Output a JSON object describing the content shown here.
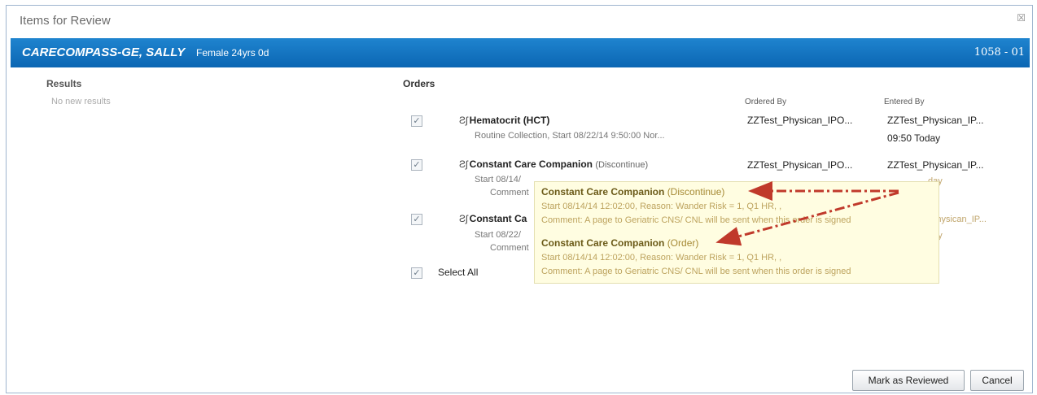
{
  "window": {
    "title": "Items for Review",
    "close_glyph": "☒"
  },
  "banner": {
    "name": "CARECOMPASS-GE, SALLY",
    "demographics": "Female 24yrs 0d",
    "location": "1058 - 01"
  },
  "results": {
    "heading": "Results",
    "empty_text": "No new results"
  },
  "orders": {
    "heading": "Orders",
    "col_ordered_by": "Ordered By",
    "col_entered_by": "Entered By",
    "items": [
      {
        "rx": "Ƨʃ",
        "title": "Hematocrit (HCT)",
        "tag": "",
        "detail1": "Routine Collection, Start 08/22/14 9:50:00 Nor...",
        "detail2": "",
        "ordered_by": "ZZTest_Physican_IPO...",
        "entered_by": "ZZTest_Physican_IP...",
        "entered_time": "09:50 Today"
      },
      {
        "rx": "Ƨʃ",
        "title": "Constant Care Companion",
        "tag": "(Discontinue)",
        "detail1": "Start 08/14/",
        "detail2": "Comment",
        "ordered_by": "ZZTest_Physican_IPO...",
        "entered_by": "ZZTest_Physican_IP...",
        "entered_time": "day"
      },
      {
        "rx": "Ƨʃ",
        "title": "Constant Ca",
        "tag": "",
        "detail1": "Start 08/22/",
        "detail2": "Comment",
        "ordered_by": "",
        "entered_by": "Physican_IP...",
        "entered_time": "day"
      }
    ],
    "select_all_label": "Select All",
    "check_glyph": "✓"
  },
  "tooltip": {
    "entries": [
      {
        "title": "Constant Care Companion",
        "tag": "(Discontinue)",
        "line1": "Start 08/14/14 12:02:00, Reason: Wander Risk = 1, Q1 HR, ,",
        "line2": "Comment: A page to Geriatric CNS/ CNL will be sent when this order is signed"
      },
      {
        "title": "Constant Care Companion",
        "tag": "(Order)",
        "line1": "Start 08/14/14 12:02:00, Reason: Wander Risk = 1, Q1 HR, ,",
        "line2": "Comment: A page to Geriatric CNS/ CNL will be sent when this order is signed"
      }
    ]
  },
  "buttons": {
    "mark_reviewed": "Mark as Reviewed",
    "cancel": "Cancel"
  },
  "colors": {
    "banner": "#0b66b3",
    "annotation_arrow": "#c0392b",
    "tooltip_bg": "#fffde1"
  }
}
